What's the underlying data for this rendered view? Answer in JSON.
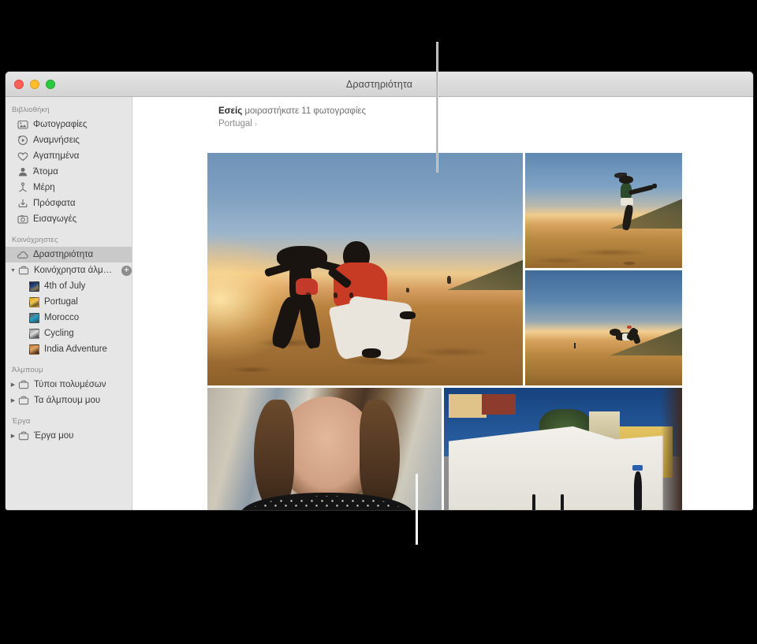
{
  "window": {
    "title": "Δραστηριότητα",
    "traffic_lights": [
      "close-red",
      "minimize-yellow",
      "zoom-green"
    ]
  },
  "sidebar": {
    "sections": [
      {
        "header": "Βιβλιοθήκη",
        "items": [
          {
            "label": "Φωτογραφίες",
            "icon": "photos-icon"
          },
          {
            "label": "Αναμνήσεις",
            "icon": "memories-icon"
          },
          {
            "label": "Αγαπημένα",
            "icon": "heart-icon"
          },
          {
            "label": "Άτομα",
            "icon": "person-icon"
          },
          {
            "label": "Μέρη",
            "icon": "places-pin-icon"
          },
          {
            "label": "Πρόσφατα",
            "icon": "recents-download-icon"
          },
          {
            "label": "Εισαγωγές",
            "icon": "imports-camera-icon"
          }
        ]
      },
      {
        "header": "Κοινόχρηστες",
        "items": [
          {
            "label": "Δραστηριότητα",
            "icon": "cloud-icon",
            "selected": true
          },
          {
            "label": "Κοινόχρηστα άλμπουμ",
            "icon": "shared-albums-folder-icon",
            "expandable": true,
            "expanded": true,
            "badge": "+"
          }
        ],
        "albums": [
          {
            "label": "4th of July",
            "thumb": "th-july"
          },
          {
            "label": "Portugal",
            "thumb": "th-portugal"
          },
          {
            "label": "Morocco",
            "thumb": "th-morocco"
          },
          {
            "label": "Cycling",
            "thumb": "th-cycling"
          },
          {
            "label": "India Adventure",
            "thumb": "th-india"
          }
        ]
      },
      {
        "header": "Άλμπουμ",
        "items": [
          {
            "label": "Τύποι πολυμέσων",
            "icon": "folder-icon",
            "expandable": true
          },
          {
            "label": "Τα άλμπουμ μου",
            "icon": "folder-icon",
            "expandable": true
          }
        ]
      },
      {
        "header": "Έργα",
        "items": [
          {
            "label": "Έργα μου",
            "icon": "folder-icon",
            "expandable": true
          }
        ]
      }
    ]
  },
  "content": {
    "share_prefix": "Εσείς",
    "share_text": " μοιραστήκατε 11 φωτογραφίες",
    "album_link": "Portugal",
    "chevron": "›",
    "photos": [
      {
        "name": "beach-capoeira-sunset",
        "position": "row1-large-left"
      },
      {
        "name": "beach-jump-kick",
        "position": "row1-right-top"
      },
      {
        "name": "beach-backflip",
        "position": "row1-right-bottom"
      },
      {
        "name": "portrait-woman-street",
        "position": "row2-left"
      },
      {
        "name": "white-wall-street-lisbon",
        "position": "row2-right"
      }
    ]
  },
  "callouts": [
    {
      "name": "callout-line-top",
      "target": "window-title-bar"
    },
    {
      "name": "callout-line-bottom",
      "target": "photo-grid"
    }
  ]
}
